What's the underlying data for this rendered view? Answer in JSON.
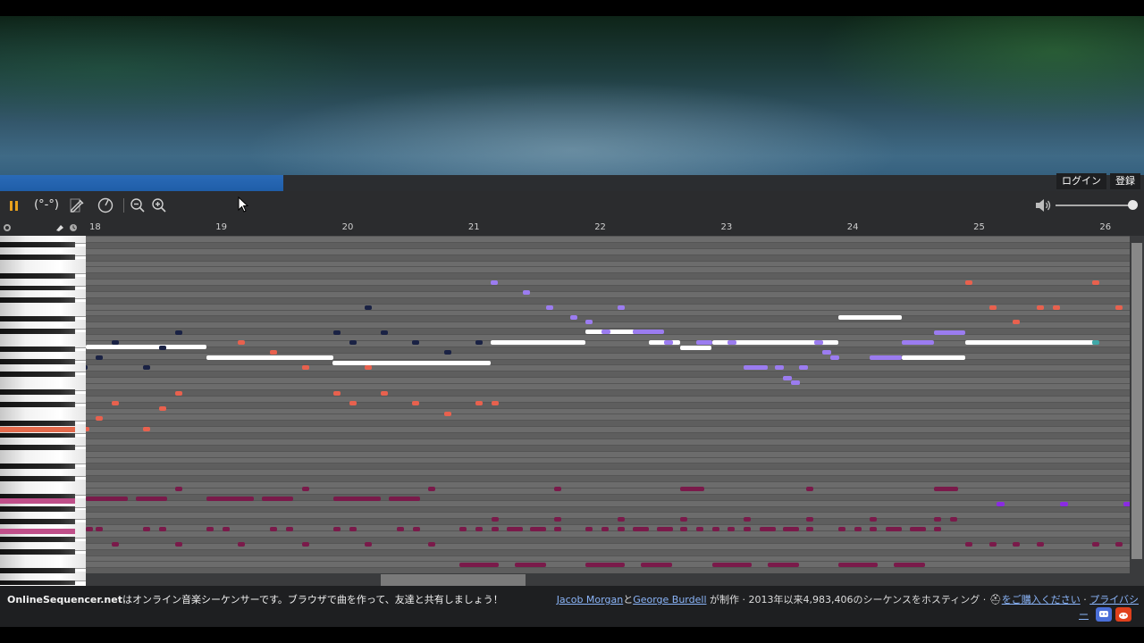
{
  "header": {
    "login_label": "ログイン",
    "register_label": "登録"
  },
  "toolbar": {
    "face_label": "(°-°)",
    "pause_icon": "pause-icon",
    "pencil_icon": "pencil-icon",
    "metronome_icon": "metronome-icon",
    "zoom_out_icon": "zoom-out-icon",
    "zoom_in_icon": "zoom-in-icon",
    "volume_icon": "volume-icon",
    "volume_level": 0.98
  },
  "ruler": {
    "measures": [
      "18",
      "19",
      "20",
      "21",
      "22",
      "23",
      "24",
      "25",
      "26"
    ]
  },
  "colors": {
    "white_notes": "#ffffff",
    "purple_notes": "#9b7cf0",
    "red_notes": "#e8614e",
    "navy_notes": "#1a2244",
    "maroon_notes": "#7a1a4a",
    "violet_notes": "#8a2be2",
    "teal_notes": "#3fa7a7",
    "accent_pause": "#e8a11d"
  },
  "footer": {
    "site_name": "OnlineSequencer.net",
    "tagline": "はオンライン音楽シーケンサーです。ブラウザで曲を作って、友達と共有しましょう！",
    "author1": "Jacob Morgan",
    "and": "と",
    "author2": "George Burdell",
    "made_by": " が制作 · 2013年以来4,983,406のシーケンスをホスティング · ",
    "buy_link": "をご購入ください",
    "sep": " · ",
    "privacy_link": "プライバシ",
    "privacy_cont": "ー",
    "discord_icon": "discord-icon",
    "reddit_icon": "reddit-icon",
    "hat_icon": "hat-icon"
  }
}
